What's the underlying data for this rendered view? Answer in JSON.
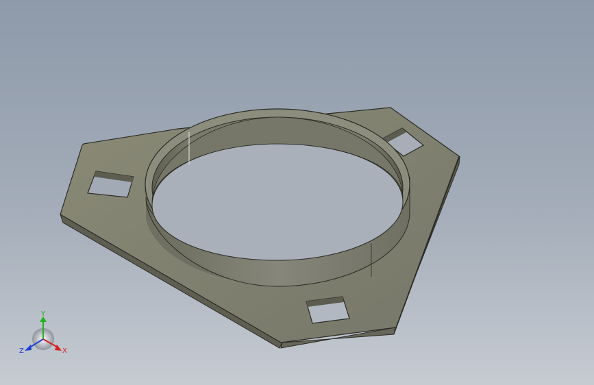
{
  "viewport": {
    "model": "three-hole-flange-bracket",
    "background_top": "#8e9aaa",
    "background_bottom": "#c6cbd2",
    "part_color": "#7f7f6d"
  },
  "triad": {
    "x_label": "X",
    "y_label": "Y",
    "z_label": "Z",
    "x_color": "#d42020",
    "y_color": "#20b020",
    "z_color": "#2040d0"
  }
}
